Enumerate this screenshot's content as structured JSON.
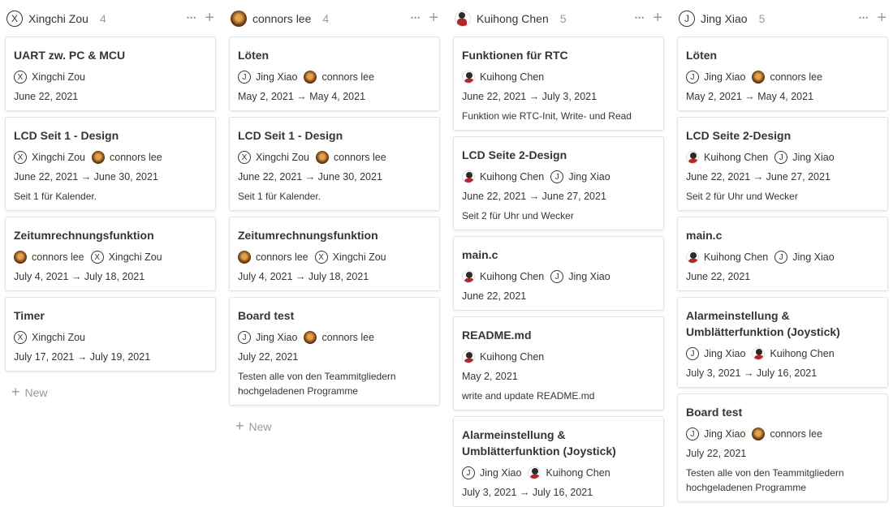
{
  "columns": [
    {
      "title": "Xingchi Zou",
      "count": "4",
      "avatar": {
        "type": "letter",
        "letter": "X"
      },
      "new_label": "New",
      "cards": [
        {
          "title": "UART zw. PC & MCU",
          "people": [
            {
              "name": "Xingchi Zou",
              "avatar": "X"
            }
          ],
          "date": "June 22, 2021",
          "desc": ""
        },
        {
          "title": "LCD Seit 1 - Design",
          "people": [
            {
              "name": "Xingchi Zou",
              "avatar": "X"
            },
            {
              "name": "connors lee",
              "avatar": "photo-c"
            }
          ],
          "date": "June 22, 2021 → June 30, 2021",
          "desc": "Seit 1 für Kalender."
        },
        {
          "title": "Zeitumrechnungsfunktion",
          "people": [
            {
              "name": "connors lee",
              "avatar": "photo-c"
            },
            {
              "name": "Xingchi Zou",
              "avatar": "X"
            }
          ],
          "date": "July 4, 2021 → July 18, 2021",
          "desc": ""
        },
        {
          "title": "Timer",
          "people": [
            {
              "name": "Xingchi Zou",
              "avatar": "X"
            }
          ],
          "date": "July 17, 2021 → July 19, 2021",
          "desc": ""
        }
      ]
    },
    {
      "title": "connors lee",
      "count": "4",
      "avatar": {
        "type": "photo-c"
      },
      "new_label": "New",
      "cards": [
        {
          "title": "Löten",
          "people": [
            {
              "name": "Jing Xiao",
              "avatar": "J"
            },
            {
              "name": "connors lee",
              "avatar": "photo-c"
            }
          ],
          "date": "May 2, 2021 → May 4, 2021",
          "desc": ""
        },
        {
          "title": "LCD Seit 1 - Design",
          "people": [
            {
              "name": "Xingchi Zou",
              "avatar": "X"
            },
            {
              "name": "connors lee",
              "avatar": "photo-c"
            }
          ],
          "date": "June 22, 2021 → June 30, 2021",
          "desc": "Seit 1 für Kalender."
        },
        {
          "title": "Zeitumrechnungsfunktion",
          "people": [
            {
              "name": "connors lee",
              "avatar": "photo-c"
            },
            {
              "name": "Xingchi Zou",
              "avatar": "X"
            }
          ],
          "date": "July 4, 2021 → July 18, 2021",
          "desc": ""
        },
        {
          "title": "Board test",
          "people": [
            {
              "name": "Jing Xiao",
              "avatar": "J"
            },
            {
              "name": "connors lee",
              "avatar": "photo-c"
            }
          ],
          "date": "July 22, 2021",
          "desc": "Testen alle von den Teammitgliedern hochgeladenen Programme"
        }
      ]
    },
    {
      "title": "Kuihong Chen",
      "count": "5",
      "avatar": {
        "type": "photo-k"
      },
      "new_label": "",
      "cards": [
        {
          "title": "Funktionen für RTC",
          "people": [
            {
              "name": "Kuihong Chen",
              "avatar": "photo-k"
            }
          ],
          "date": "June 22, 2021 → July 3, 2021",
          "desc": "Funktion wie RTC-Init, Write- und Read"
        },
        {
          "title": "LCD Seite 2-Design",
          "people": [
            {
              "name": "Kuihong Chen",
              "avatar": "photo-k"
            },
            {
              "name": "Jing Xiao",
              "avatar": "J"
            }
          ],
          "date": "June 22, 2021 → June 27, 2021",
          "desc": "Seit 2 für Uhr und Wecker"
        },
        {
          "title": "main.c",
          "people": [
            {
              "name": "Kuihong Chen",
              "avatar": "photo-k"
            },
            {
              "name": "Jing Xiao",
              "avatar": "J"
            }
          ],
          "date": "June 22, 2021",
          "desc": ""
        },
        {
          "title": "README.md",
          "people": [
            {
              "name": "Kuihong Chen",
              "avatar": "photo-k"
            }
          ],
          "date": "May 2, 2021",
          "desc": "write and update README.md"
        },
        {
          "title": "Alarmeinstellung & Umblätterfunktion (Joystick)",
          "people": [
            {
              "name": "Jing Xiao",
              "avatar": "J"
            },
            {
              "name": "Kuihong Chen",
              "avatar": "photo-k"
            }
          ],
          "date": "July 3, 2021 → July 16, 2021",
          "desc": ""
        }
      ]
    },
    {
      "title": "Jing Xiao",
      "count": "5",
      "avatar": {
        "type": "letter",
        "letter": "J"
      },
      "new_label": "",
      "cards": [
        {
          "title": "Löten",
          "people": [
            {
              "name": "Jing Xiao",
              "avatar": "J"
            },
            {
              "name": "connors lee",
              "avatar": "photo-c"
            }
          ],
          "date": "May 2, 2021 → May 4, 2021",
          "desc": ""
        },
        {
          "title": "LCD Seite 2-Design",
          "people": [
            {
              "name": "Kuihong Chen",
              "avatar": "photo-k"
            },
            {
              "name": "Jing Xiao",
              "avatar": "J"
            }
          ],
          "date": "June 22, 2021 → June 27, 2021",
          "desc": "Seit 2 für Uhr und Wecker"
        },
        {
          "title": "main.c",
          "people": [
            {
              "name": "Kuihong Chen",
              "avatar": "photo-k"
            },
            {
              "name": "Jing Xiao",
              "avatar": "J"
            }
          ],
          "date": "June 22, 2021",
          "desc": ""
        },
        {
          "title": "Alarmeinstellung & Umblätterfunktion (Joystick)",
          "people": [
            {
              "name": "Jing Xiao",
              "avatar": "J"
            },
            {
              "name": "Kuihong Chen",
              "avatar": "photo-k"
            }
          ],
          "date": "July 3, 2021 → July 16, 2021",
          "desc": ""
        },
        {
          "title": "Board test",
          "people": [
            {
              "name": "Jing Xiao",
              "avatar": "J"
            },
            {
              "name": "connors lee",
              "avatar": "photo-c"
            }
          ],
          "date": "July 22, 2021",
          "desc": "Testen alle von den Teammitgliedern hochgeladenen Programme"
        }
      ]
    }
  ]
}
